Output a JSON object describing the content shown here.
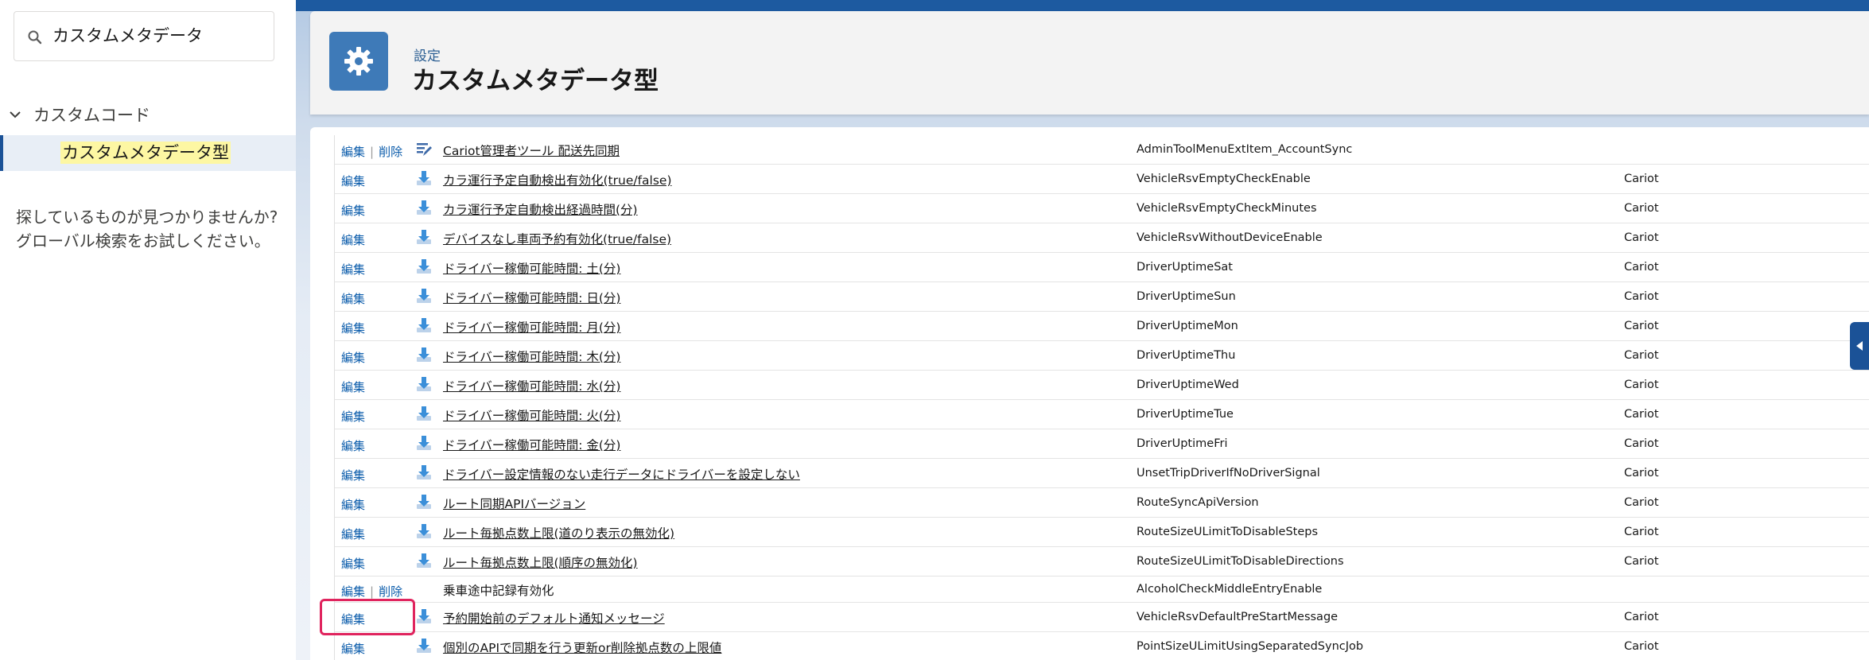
{
  "sidebar": {
    "search_value": "カスタムメタデータ",
    "tree_parent_label": "カスタムコード",
    "tree_child_label": "カスタムメタデータ型",
    "help_line1": "探しているものが見つかりませんか?",
    "help_line2": "グローバル検索をお試しください。"
  },
  "header": {
    "eyebrow": "設定",
    "title": "カスタムメタデータ型"
  },
  "actions": {
    "edit": "編集",
    "delete": "削除",
    "separator": "|"
  },
  "rows": [
    {
      "label": "Cariot管理者ツール 配送先同期",
      "api": "AdminToolMenuExtItem_AccountSync",
      "ns": "",
      "delete": true,
      "icon": "pencil-doc-icon"
    },
    {
      "label": "カラ運行予定自動検出有効化(true/false)",
      "api": "VehicleRsvEmptyCheckEnable",
      "ns": "Cariot",
      "delete": false,
      "icon": "download-icon"
    },
    {
      "label": "カラ運行予定自動検出経過時間(分)",
      "api": "VehicleRsvEmptyCheckMinutes",
      "ns": "Cariot",
      "delete": false,
      "icon": "download-icon"
    },
    {
      "label": "デバイスなし車両予約有効化(true/false)",
      "api": "VehicleRsvWithoutDeviceEnable",
      "ns": "Cariot",
      "delete": false,
      "icon": "download-icon"
    },
    {
      "label": "ドライバー稼働可能時間: 土(分)",
      "api": "DriverUptimeSat",
      "ns": "Cariot",
      "delete": false,
      "icon": "download-icon"
    },
    {
      "label": "ドライバー稼働可能時間: 日(分)",
      "api": "DriverUptimeSun",
      "ns": "Cariot",
      "delete": false,
      "icon": "download-icon"
    },
    {
      "label": "ドライバー稼働可能時間: 月(分)",
      "api": "DriverUptimeMon",
      "ns": "Cariot",
      "delete": false,
      "icon": "download-icon"
    },
    {
      "label": "ドライバー稼働可能時間: 木(分)",
      "api": "DriverUptimeThu",
      "ns": "Cariot",
      "delete": false,
      "icon": "download-icon"
    },
    {
      "label": "ドライバー稼働可能時間: 水(分)",
      "api": "DriverUptimeWed",
      "ns": "Cariot",
      "delete": false,
      "icon": "download-icon"
    },
    {
      "label": "ドライバー稼働可能時間: 火(分)",
      "api": "DriverUptimeTue",
      "ns": "Cariot",
      "delete": false,
      "icon": "download-icon"
    },
    {
      "label": "ドライバー稼働可能時間: 金(分)",
      "api": "DriverUptimeFri",
      "ns": "Cariot",
      "delete": false,
      "icon": "download-icon"
    },
    {
      "label": "ドライバー設定情報のない走行データにドライバーを設定しない",
      "api": "UnsetTripDriverIfNoDriverSignal",
      "ns": "Cariot",
      "delete": false,
      "icon": "download-icon"
    },
    {
      "label": "ルート同期APIバージョン",
      "api": "RouteSyncApiVersion",
      "ns": "Cariot",
      "delete": false,
      "icon": "download-icon"
    },
    {
      "label": "ルート毎拠点数上限(道のり表示の無効化)",
      "api": "RouteSizeULimitToDisableSteps",
      "ns": "Cariot",
      "delete": false,
      "icon": "download-icon"
    },
    {
      "label": "ルート毎拠点数上限(順序の無効化)",
      "api": "RouteSizeULimitToDisableDirections",
      "ns": "Cariot",
      "delete": false,
      "icon": "download-icon"
    },
    {
      "label": "乗車途中記録有効化",
      "api": "AlcoholCheckMiddleEntryEnable",
      "ns": "",
      "delete": true,
      "icon": ""
    },
    {
      "label": "予約開始前のデフォルト通知メッセージ",
      "api": "VehicleRsvDefaultPreStartMessage",
      "ns": "Cariot",
      "delete": false,
      "icon": "download-icon"
    },
    {
      "label": "個別のAPIで同期を行う更新or削除拠点数の上限値",
      "api": "PointSizeULimitUsingSeparatedSyncJob",
      "ns": "Cariot",
      "delete": false,
      "icon": "download-icon"
    }
  ]
}
